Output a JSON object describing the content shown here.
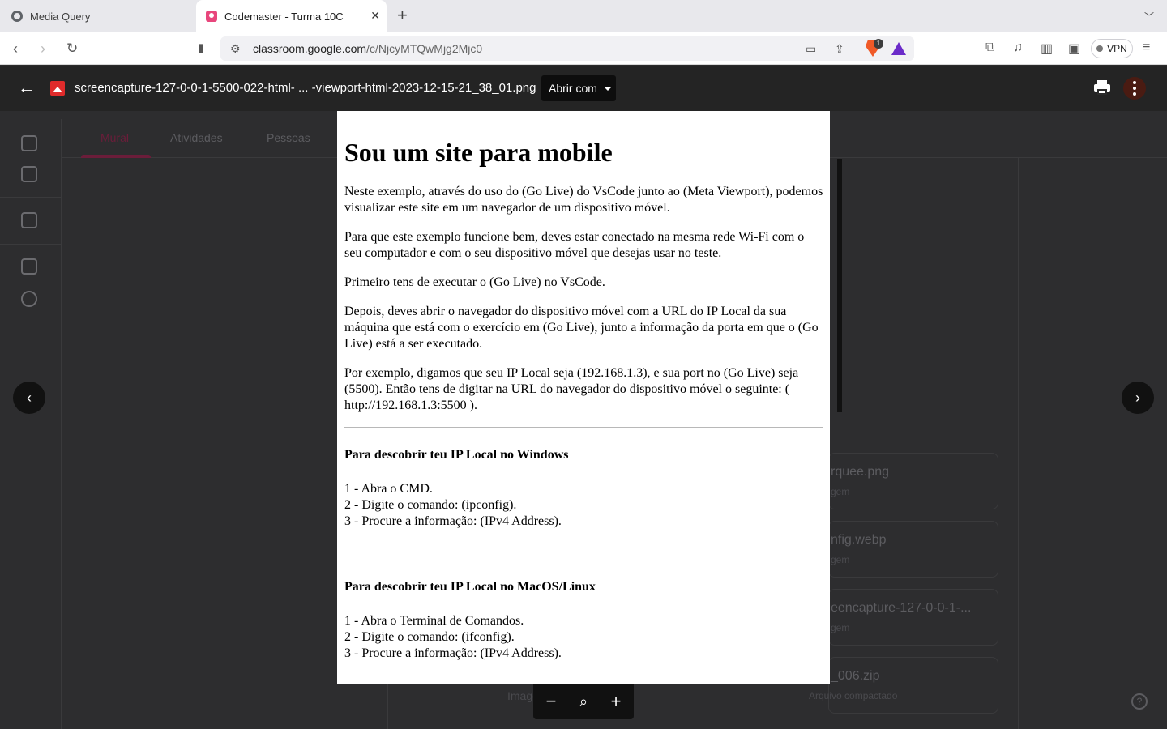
{
  "browser": {
    "tabs": [
      {
        "title": "Media Query"
      },
      {
        "title": "Codemaster - Turma 10C"
      }
    ],
    "url_domain": "classroom.google.com",
    "url_path": "/c/NjcyMTQwMjg2Mjc0",
    "brave_badge": "1",
    "vpn_label": "VPN"
  },
  "classroom": {
    "tabs": [
      "Mural",
      "Atividades",
      "Pessoas"
    ],
    "cards": [
      {
        "title": "rquee.png",
        "subtitle": "gem"
      },
      {
        "title": "nfig.webp",
        "subtitle": "gem"
      },
      {
        "title": "eencapture-127-0-0-1-...",
        "subtitle": "gem"
      },
      {
        "title": "_006.zip",
        "subtitle": "Arquivo compactado"
      }
    ],
    "partial_label": "Image"
  },
  "viewer": {
    "file_name": "screencapture-127-0-0-1-5500-022-html- ... -viewport-html-2023-12-15-21_38_01.png",
    "open_with": "Abrir com"
  },
  "document": {
    "title": "Sou um site para mobile",
    "paragraphs": [
      "Neste exemplo, através do uso do (Go Live) do VsCode junto ao (Meta Viewport), podemos visualizar este site em um navegador de um dispositivo móvel.",
      "Para que este exemplo funcione bem, deves estar conectado na mesma rede Wi-Fi com o seu computador e com o seu dispositivo móvel que desejas usar no teste.",
      "Primeiro tens de executar o (Go Live) no VsCode.",
      "Depois, deves abrir o navegador do dispositivo móvel com a URL do IP Local da sua máquina que está com o exercício em (Go Live), junto a informação da porta em que o (Go Live) está a ser executado.",
      "Por exemplo, digamos que seu IP Local seja (192.168.1.3), e sua port no (Go Live) seja (5500). Então tens de digitar na URL do navegador do dispositivo móvel o seguinte: ( http://192.168.1.3:5500 )."
    ],
    "windows": {
      "heading": "Para descobrir teu IP Local no Windows",
      "steps": [
        "1 - Abra o CMD.",
        "2 - Digite o comando: (ipconfig).",
        "3 - Procure a informação: (IPv4 Address)."
      ]
    },
    "macos": {
      "heading": "Para descobrir teu IP Local no MacOS/Linux",
      "steps": [
        "1 - Abra o Terminal de Comandos.",
        "2 - Digite o comando: (ifconfig).",
        "3 - Procure a informação: (IPv4 Address)."
      ]
    }
  }
}
